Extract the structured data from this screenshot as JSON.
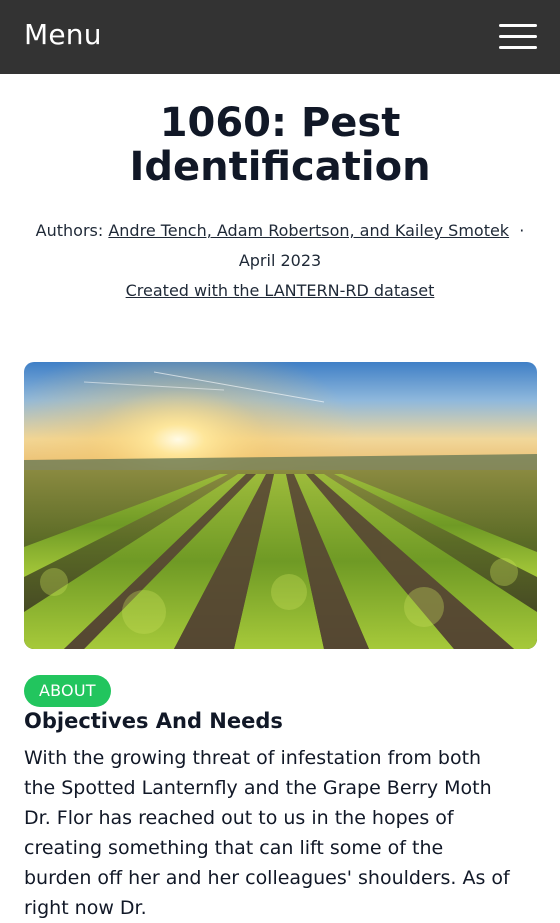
{
  "header": {
    "menu_label": "Menu",
    "menu_icon": "hamburger-icon"
  },
  "article": {
    "title": "1060: Pest Identification",
    "authors_prefix": "Authors:",
    "authors_link": "Andre Tench, Adam Robertson, and Kailey Smotek",
    "date": "· April 2023",
    "dataset_link": "Created with the LANTERN-RD dataset",
    "hero_image": "vineyard-sunset-image"
  },
  "section": {
    "badge": "ABOUT",
    "heading": "Objectives And Needs",
    "body": "With the growing threat of infestation from both the Spotted Lanternfly and the Grape Berry Moth Dr. Flor has reached out to us in the hopes of creating something that can lift some of the burden off her and her colleagues' shoulders. As of right now Dr."
  },
  "colors": {
    "header_bg": "#333333",
    "badge_bg": "#22c55e",
    "text": "#111827"
  }
}
